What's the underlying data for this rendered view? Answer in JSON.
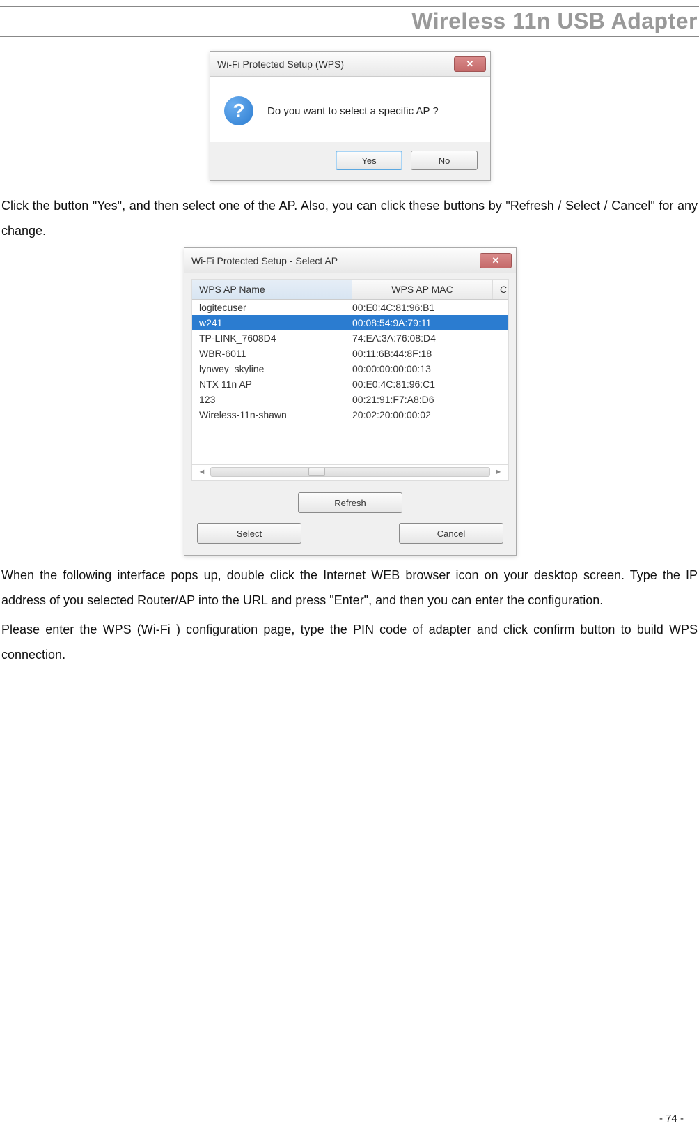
{
  "header": {
    "title": "Wireless 11n USB Adapter"
  },
  "dialog1": {
    "title": "Wi-Fi Protected Setup (WPS)",
    "close_symbol": "✕",
    "question_symbol": "?",
    "message": "Do you want to select a specific AP ?",
    "yes_label": "Yes",
    "no_label": "No"
  },
  "paragraph1": "Click the button \"Yes\", and then select one of the AP. Also, you can click these buttons by \"Refresh / Select / Cancel\" for any change.",
  "dialog2": {
    "title": "Wi-Fi Protected Setup - Select AP",
    "close_symbol": "✕",
    "columns": {
      "name": "WPS AP Name",
      "mac": "WPS AP MAC",
      "last": "C"
    },
    "rows": [
      {
        "name": "logitecuser",
        "mac": "00:E0:4C:81:96:B1",
        "selected": false
      },
      {
        "name": "w241",
        "mac": "00:08:54:9A:79:11",
        "selected": true
      },
      {
        "name": "TP-LINK_7608D4",
        "mac": "74:EA:3A:76:08:D4",
        "selected": false
      },
      {
        "name": "WBR-6011",
        "mac": "00:11:6B:44:8F:18",
        "selected": false
      },
      {
        "name": "lynwey_skyline",
        "mac": "00:00:00:00:00:13",
        "selected": false
      },
      {
        "name": "NTX 11n AP",
        "mac": "00:E0:4C:81:96:C1",
        "selected": false
      },
      {
        "name": "123",
        "mac": "00:21:91:F7:A8:D6",
        "selected": false
      },
      {
        "name": "Wireless-11n-shawn",
        "mac": "20:02:20:00:00:02",
        "selected": false
      }
    ],
    "refresh_label": "Refresh",
    "select_label": "Select",
    "cancel_label": "Cancel",
    "scroll_left": "◄",
    "scroll_right": "►"
  },
  "paragraph2": "When the following interface pops up, double click the Internet WEB browser icon on your desktop screen. Type the IP address of you selected Router/AP into the URL and press \"Enter\", and then you can enter the configuration.",
  "paragraph3": "Please enter the WPS (Wi-Fi ) configuration page, type the PIN code of adapter and click confirm button to build WPS connection.",
  "page_number": "- 74 -"
}
